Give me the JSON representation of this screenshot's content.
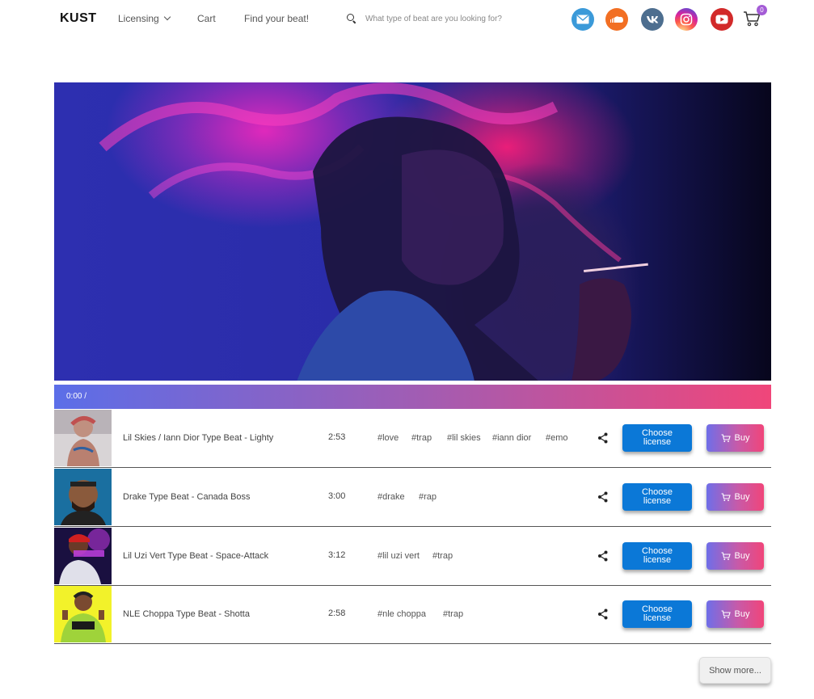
{
  "header": {
    "logo": "KUST",
    "nav": {
      "licensing": "Licensing",
      "cart": "Cart",
      "find_beat": "Find your beat!"
    },
    "search": {
      "placeholder": "What type of beat are you looking for?",
      "value": ""
    },
    "social_icons": [
      "mail-icon",
      "soundcloud-icon",
      "vk-icon",
      "instagram-icon",
      "youtube-icon"
    ],
    "cart_count": "0"
  },
  "player": {
    "time": "0:00 /",
    "gradient_colors": [
      "#5b6ee8",
      "#a05db4",
      "#f0467a"
    ]
  },
  "tracks": [
    {
      "title": "Lil Skies / Iann Dior Type Beat - Lighty",
      "duration": "2:53",
      "tags": [
        "#love",
        "#trap",
        "#lil skies",
        "#iann dior",
        "#emo"
      ]
    },
    {
      "title": "Drake Type Beat - Canada Boss",
      "duration": "3:00",
      "tags": [
        "#drake",
        "#rap"
      ]
    },
    {
      "title": "Lil Uzi Vert Type Beat - Space-Attack",
      "duration": "3:12",
      "tags": [
        "#lil uzi vert",
        "#trap"
      ]
    },
    {
      "title": "NLE Choppa Type Beat - Shotta",
      "duration": "2:58",
      "tags": [
        "#nle choppa",
        "#trap"
      ]
    }
  ],
  "buttons": {
    "choose_license": "Choose license",
    "buy": "Buy",
    "show_more": "Show more..."
  },
  "colors": {
    "license_button": "#0b78d7",
    "buy_gradient": [
      "#6f6ee8",
      "#c85aa8",
      "#f0457a"
    ],
    "cart_badge": "#a45cd6"
  }
}
